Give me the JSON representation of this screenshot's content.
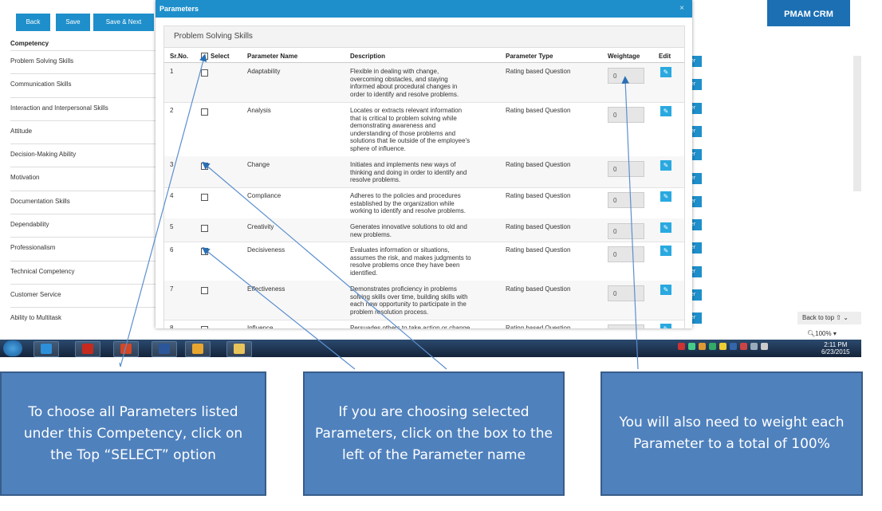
{
  "app": {
    "toolbar": {
      "back": "Back",
      "save": "Save",
      "save_next": "Save & Next"
    },
    "brand": "PMAM CRM",
    "competency_header": "Competency",
    "competencies": [
      "Problem Solving Skills",
      "Communication Skills",
      "Interaction and Interpersonal Skills",
      "Attitude",
      "Decision-Making Ability",
      "Motivation",
      "Documentation Skills",
      "Dependability",
      "Professionalism",
      "Technical Competency",
      "Customer Service",
      "Ability to Multitask"
    ],
    "side_tab_label": "er",
    "back_to_top": "Back to top",
    "zoom": "100%"
  },
  "modal": {
    "title": "Parameters",
    "close": "×",
    "panel_title": "Problem Solving Skills",
    "columns": {
      "srno": "Sr.No.",
      "select": "Select",
      "name": "Parameter Name",
      "description": "Description",
      "type": "Parameter Type",
      "weightage": "Weightage",
      "edit": "Edit"
    },
    "rows": [
      {
        "no": "1",
        "name": "Adaptability",
        "desc": [
          "Flexible in dealing with change,",
          "overcoming obstacles, and staying",
          "informed about procedural changes in",
          "order to identify and resolve problems."
        ],
        "type": "Rating based Question",
        "weight": "0"
      },
      {
        "no": "2",
        "name": "Analysis",
        "desc": [
          "Locates or extracts relevant information",
          "that is critical to problem solving while",
          "demonstrating awareness and",
          "understanding of those problems and",
          "solutions that lie outside of the employee's",
          "sphere of influence."
        ],
        "type": "Rating based Question",
        "weight": "0"
      },
      {
        "no": "3",
        "name": "Change",
        "desc": [
          "Initiates and implements new ways of",
          "thinking and doing in order to identify and",
          "resolve problems."
        ],
        "type": "Rating based Question",
        "weight": "0"
      },
      {
        "no": "4",
        "name": "Compliance",
        "desc": [
          "Adheres to the policies and procedures",
          "established by the organization while",
          "working to identify and resolve problems."
        ],
        "type": "Rating based Question",
        "weight": "0"
      },
      {
        "no": "5",
        "name": "Creativity",
        "desc": [
          "Generates innovative solutions to old and",
          "new problems."
        ],
        "type": "Rating based Question",
        "weight": "0"
      },
      {
        "no": "6",
        "name": "Decisiveness",
        "desc": [
          "Evaluates information or situations,",
          "assumes the risk, and makes judgments to",
          "resolve problems once they have been",
          "identified."
        ],
        "type": "Rating based Question",
        "weight": "0"
      },
      {
        "no": "7",
        "name": "Effectiveness",
        "desc": [
          "Demonstrates proficiency in problems",
          "solving skills over time, building skills with",
          "each new opportunity to participate in the",
          "problem resolution process."
        ],
        "type": "Rating based Question",
        "weight": "0"
      },
      {
        "no": "8",
        "name": "Influence",
        "desc": [
          "Persuades others to take action or change"
        ],
        "type": "Rating based Question",
        "weight": ""
      }
    ]
  },
  "taskbar": {
    "time": "2:11 PM",
    "date": "6/23/2015"
  },
  "callouts": {
    "select_all": "To choose all Parameters listed under this Competency, click on the Top “SELECT” option",
    "select_some": "If you are choosing selected Parameters, click on the box to the left of the Parameter name",
    "weight": "You will also need to weight each Parameter to a total of 100%"
  },
  "colors": {
    "accent": "#1e8fcb",
    "callout": "#4f81bd",
    "brand": "#1c6fb3"
  }
}
